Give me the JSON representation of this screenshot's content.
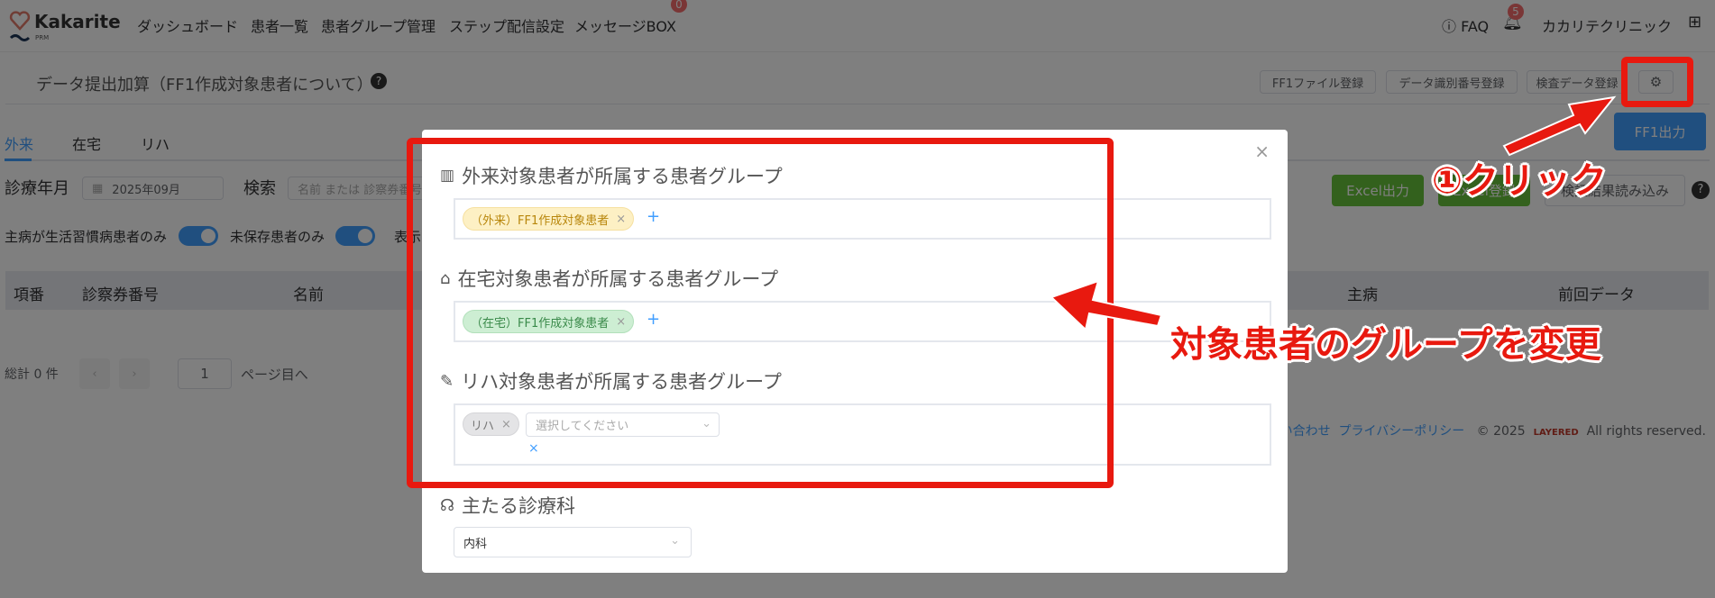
{
  "nav": {
    "brand": "Kakarite",
    "brand_sub": "PRM",
    "items": [
      "ダッシュボード",
      "患者一覧",
      "患者グループ管理",
      "ステップ配信設定",
      "メッセージBOX"
    ],
    "message_badge": "0",
    "faq": "FAQ",
    "notification_badge": "5",
    "clinic": "カカリテクリニック"
  },
  "page": {
    "title": "データ提出加算（FF1作成対象患者について）",
    "buttons": {
      "ff1_file": "FF1ファイル登録",
      "data_id": "データ識別番号登録",
      "exam_data": "検査データ登録",
      "ff1_output": "FF1出力"
    }
  },
  "tabs": [
    "外来",
    "在宅",
    "リハ"
  ],
  "filters": {
    "month_label": "診療年月",
    "month_value": "2025年09月",
    "search_label": "検索",
    "search_placeholder": "名前 または 診察券番号",
    "toggle1": "主病が生活習慣病患者のみ",
    "toggle2": "未保存患者のみ",
    "toggle3": "表示",
    "excel_output": "Excel出力",
    "excel_register": "Excel登録",
    "verify_load": "検証結果読み込み"
  },
  "table": {
    "headers": [
      "項番",
      "診察券番号",
      "名前",
      "主病",
      "前回データ"
    ]
  },
  "pager": {
    "total": "総計 0 件",
    "page": "1",
    "goto": "ページ目へ"
  },
  "footer": {
    "contact": "お問い合わせ",
    "privacy": "プライバシーポリシー",
    "copyright": "© 2025",
    "company": "LAYERED",
    "rights": "All rights reserved."
  },
  "modal": {
    "sections": [
      {
        "label": "外来対象患者が所属する患者グループ",
        "tag": "（外来）FF1作成対象患者"
      },
      {
        "label": "在宅対象患者が所属する患者グループ",
        "tag": "（在宅）FF1作成対象患者"
      },
      {
        "label": "リハ対象患者が所属する患者グループ",
        "tag": "リハ",
        "select_placeholder": "選択してください"
      }
    ],
    "department_label": "主たる診療科",
    "department_value": "内科"
  },
  "annotations": {
    "click": "①クリック",
    "change": "対象患者のグループを変更"
  },
  "colors": {
    "primary": "#409eff",
    "success": "#67c23a",
    "annotation": "#e8190f"
  }
}
